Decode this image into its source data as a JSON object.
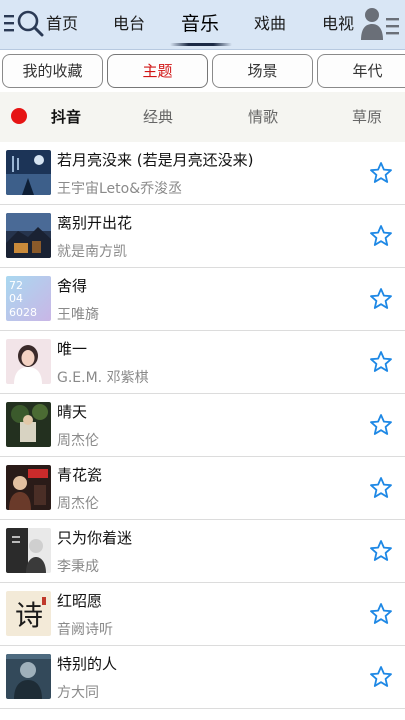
{
  "nav": {
    "tabs": [
      "首页",
      "电台",
      "音乐",
      "戏曲",
      "电视"
    ],
    "active": "音乐"
  },
  "categories": [
    "我的收藏",
    "主题",
    "场景",
    "年代"
  ],
  "active_category": "主题",
  "subtabs": [
    "抖音",
    "经典",
    "情歌",
    "草原"
  ],
  "active_subtab": "抖音",
  "songs": [
    {
      "title": "若月亮没来 (若是月亮还没来)",
      "artist": "王宇宙Leto&乔浚丞"
    },
    {
      "title": "离别开出花",
      "artist": "就是南方凯"
    },
    {
      "title": "舍得",
      "artist": "王唯旖"
    },
    {
      "title": "唯一",
      "artist": "G.E.M. 邓紫棋"
    },
    {
      "title": "晴天",
      "artist": "周杰伦"
    },
    {
      "title": "青花瓷",
      "artist": "周杰伦"
    },
    {
      "title": "只为你着迷",
      "artist": "李秉成"
    },
    {
      "title": "红昭愿",
      "artist": "音阙诗听"
    },
    {
      "title": "特别的人",
      "artist": "方大同"
    }
  ],
  "cover_texts": {
    "shede": [
      "72",
      "04",
      "6028"
    ],
    "honzhaoyuan": "诗"
  },
  "colors": {
    "accent_red": "#d11515",
    "star_blue": "#1e88e5",
    "nav_bg": "#d9e6f5"
  }
}
